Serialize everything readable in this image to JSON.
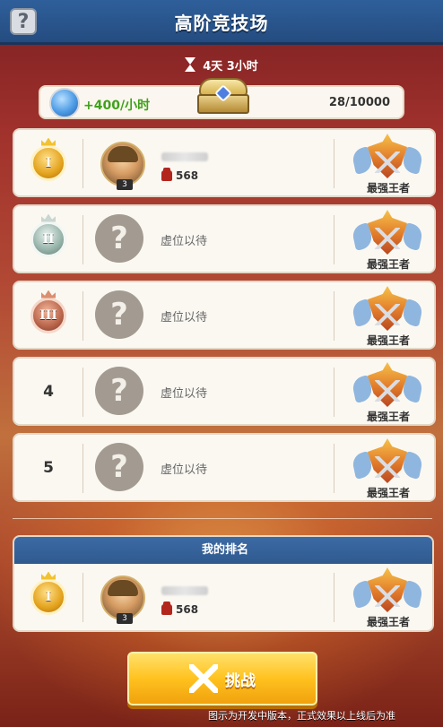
{
  "header": {
    "title": "高阶竞技场",
    "help_label": "?"
  },
  "timer": {
    "text": "4天 3小时"
  },
  "reward": {
    "rate": "+400/小时",
    "count": "28/10000"
  },
  "ranks": [
    {
      "rank_label": "I",
      "medal": "gold",
      "occupied": true,
      "level": "3",
      "power": "568",
      "title": "最强王者"
    },
    {
      "rank_label": "II",
      "medal": "silver",
      "occupied": false,
      "vacant_text": "虚位以待",
      "placeholder_glyph": "?",
      "title": "最强王者"
    },
    {
      "rank_label": "III",
      "medal": "bronze",
      "occupied": false,
      "vacant_text": "虚位以待",
      "placeholder_glyph": "?",
      "title": "最强王者"
    },
    {
      "rank_label": "4",
      "occupied": false,
      "vacant_text": "虚位以待",
      "placeholder_glyph": "?",
      "title": "最强王者"
    },
    {
      "rank_label": "5",
      "occupied": false,
      "vacant_text": "虚位以待",
      "placeholder_glyph": "?",
      "title": "最强王者"
    }
  ],
  "my_rank": {
    "heading": "我的排名",
    "rank_label": "I",
    "level": "3",
    "power": "568",
    "title": "最强王者"
  },
  "challenge": {
    "label": "挑战"
  },
  "footer": {
    "note": "图示为开发中版本，正式效果以上线后为准"
  },
  "colors": {
    "header": "#2f5f9a",
    "reward_green": "#3fa11a",
    "button": "#ffc21f"
  }
}
